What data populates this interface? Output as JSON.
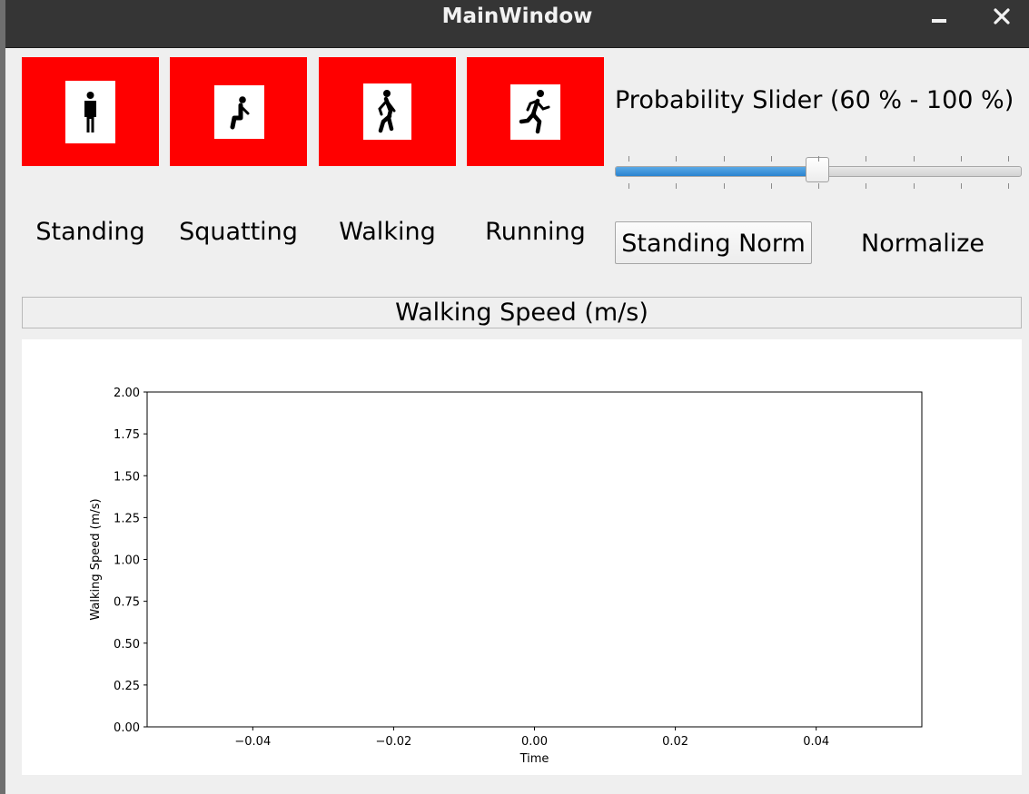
{
  "window": {
    "title": "MainWindow"
  },
  "activities": [
    {
      "label": "Standing",
      "icon": "standing-person-icon",
      "color": "#ff0000"
    },
    {
      "label": "Squatting",
      "icon": "squatting-person-icon",
      "color": "#ff0000"
    },
    {
      "label": "Walking",
      "icon": "walking-person-icon",
      "color": "#ff0000"
    },
    {
      "label": "Running",
      "icon": "running-person-icon",
      "color": "#ff0000"
    }
  ],
  "probability": {
    "label": "Probability Slider (60  % - 100 %)",
    "min": 60,
    "max": 100,
    "fill_fraction": 0.5
  },
  "buttons": {
    "standing_norm": "Standing Norm",
    "normalize": "Normalize"
  },
  "speed_panel": {
    "header": "Walking Speed (m/s)"
  },
  "chart_data": {
    "type": "line",
    "title": "",
    "xlabel": "Time",
    "ylabel": "Walking Speed (m/s)",
    "xlim": [
      -0.055,
      0.055
    ],
    "ylim": [
      0,
      2
    ],
    "xticks": [
      -0.04,
      -0.02,
      0.0,
      0.02,
      0.04
    ],
    "xtick_labels": [
      "−0.04",
      "−0.02",
      "0.00",
      "0.02",
      "0.04"
    ],
    "yticks": [
      0,
      0.25,
      0.5,
      0.75,
      1.0,
      1.25,
      1.5,
      1.75,
      2.0
    ],
    "ytick_labels": [
      "0.00",
      "0.25",
      "0.50",
      "0.75",
      "1.00",
      "1.25",
      "1.50",
      "1.75",
      "2.00"
    ],
    "series": [],
    "grid": false
  }
}
